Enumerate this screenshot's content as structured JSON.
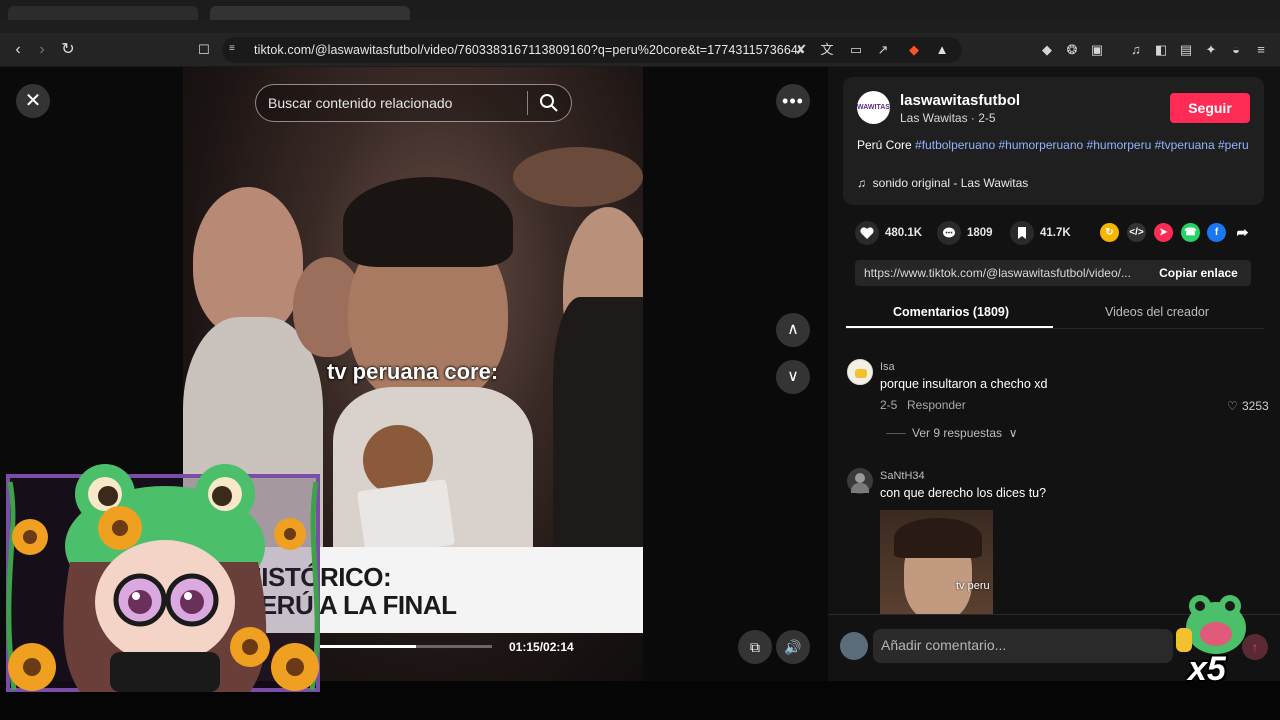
{
  "browser": {
    "url": "tiktok.com/@laswawitasfutbol/video/7603383167113809160?q=peru%20core&t=1774311573664"
  },
  "video": {
    "search_placeholder": "Buscar contenido relacionado",
    "overlay_caption": "tv peruana core:",
    "banner_line1": "HISTÓRICO:",
    "banner_line2": "PERÚ A LA FINAL",
    "time": "01:15/02:14",
    "progress_fraction": 0.56
  },
  "author": {
    "avatar_text": "WAWITAS",
    "username": "laswawitasfutbol",
    "subtitle": "Las Wawitas · 2-5",
    "follow_label": "Seguir"
  },
  "description": {
    "text": "Perú Core",
    "hashtags": [
      "#futbolperuano",
      "#humorperuano",
      "#humorperu",
      "#tvperuana",
      "#peru"
    ]
  },
  "music": {
    "label": "sonido original - Las Wawitas"
  },
  "stats": {
    "likes": "480.1K",
    "comments": "1809",
    "saves": "41.7K"
  },
  "share": {
    "link": "https://www.tiktok.com/@laswawitasfutbol/video/...",
    "copy_label": "Copiar enlace"
  },
  "tabs": {
    "comments_label": "Comentarios (1809)",
    "creator_label": "Videos del creador"
  },
  "comments": [
    {
      "user": "Isa",
      "text": "porque insultaron a checho xd",
      "date": "2-5",
      "reply_label": "Responder",
      "likes": "3253",
      "replies_label": "Ver 9 respuestas"
    },
    {
      "user": "SaNtH34",
      "text": "con que derecho los dices tu?",
      "gif_caption": "tv peru"
    }
  ],
  "add_comment": {
    "placeholder": "Añadir comentario..."
  },
  "overlay": {
    "multiplier": "x5"
  }
}
